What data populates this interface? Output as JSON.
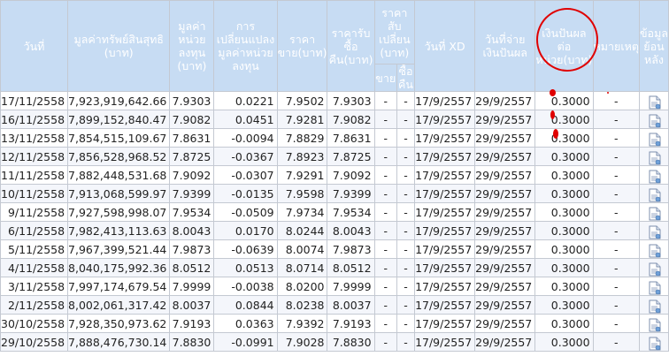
{
  "headers": {
    "date": "วันที่",
    "nav": "มูลค่าทรัพย์สินสุทธิ (บาท)",
    "nav_unit": "มูลค่า หน่วย ลงทุน (บาท)",
    "change": "การเปลี่ยนแปลง มูลค่าหน่วย ลงทุน",
    "sell": "ราคา ขาย(บาท)",
    "buyback": "ราคารับ ซื้อ คืน(บาท)",
    "switch": "ราคาสับ เปลี่ยน (บาท)",
    "switch_sell": "ขาย",
    "switch_buy": "ซื้อ คืน",
    "xd": "วันที่ XD",
    "paydate": "วันที่จ่าย เงินปันผล",
    "dividend": "เงินปันผล ต่อ หน่วย(บาท)",
    "remark": "หมายเหตุ",
    "history": "ข้อมูล ย้อน หลัง"
  },
  "rows": [
    {
      "date": "17/11/2558",
      "nav": "7,923,919,642.66",
      "unit": "7.9303",
      "change": "0.0221",
      "sell": "7.9502",
      "buy": "7.9303",
      "ssell": "-",
      "sbuy": "-",
      "xd": "17/9/2557",
      "pay": "29/9/2557",
      "div": "0.3000",
      "remark": "-"
    },
    {
      "date": "16/11/2558",
      "nav": "7,899,152,840.47",
      "unit": "7.9082",
      "change": "0.0451",
      "sell": "7.9281",
      "buy": "7.9082",
      "ssell": "-",
      "sbuy": "-",
      "xd": "17/9/2557",
      "pay": "29/9/2557",
      "div": "0.3000",
      "remark": "-"
    },
    {
      "date": "13/11/2558",
      "nav": "7,854,515,109.67",
      "unit": "7.8631",
      "change": "-0.0094",
      "sell": "7.8829",
      "buy": "7.8631",
      "ssell": "-",
      "sbuy": "-",
      "xd": "17/9/2557",
      "pay": "29/9/2557",
      "div": "0.3000",
      "remark": "-"
    },
    {
      "date": "12/11/2558",
      "nav": "7,856,528,968.52",
      "unit": "7.8725",
      "change": "-0.0367",
      "sell": "7.8923",
      "buy": "7.8725",
      "ssell": "-",
      "sbuy": "-",
      "xd": "17/9/2557",
      "pay": "29/9/2557",
      "div": "0.3000",
      "remark": "-"
    },
    {
      "date": "11/11/2558",
      "nav": "7,882,448,531.68",
      "unit": "7.9092",
      "change": "-0.0307",
      "sell": "7.9291",
      "buy": "7.9092",
      "ssell": "-",
      "sbuy": "-",
      "xd": "17/9/2557",
      "pay": "29/9/2557",
      "div": "0.3000",
      "remark": "-"
    },
    {
      "date": "10/11/2558",
      "nav": "7,913,068,599.97",
      "unit": "7.9399",
      "change": "-0.0135",
      "sell": "7.9598",
      "buy": "7.9399",
      "ssell": "-",
      "sbuy": "-",
      "xd": "17/9/2557",
      "pay": "29/9/2557",
      "div": "0.3000",
      "remark": "-"
    },
    {
      "date": "9/11/2558",
      "nav": "7,927,598,998.07",
      "unit": "7.9534",
      "change": "-0.0509",
      "sell": "7.9734",
      "buy": "7.9534",
      "ssell": "-",
      "sbuy": "-",
      "xd": "17/9/2557",
      "pay": "29/9/2557",
      "div": "0.3000",
      "remark": "-"
    },
    {
      "date": "6/11/2558",
      "nav": "7,982,413,113.63",
      "unit": "8.0043",
      "change": "0.0170",
      "sell": "8.0244",
      "buy": "8.0043",
      "ssell": "-",
      "sbuy": "-",
      "xd": "17/9/2557",
      "pay": "29/9/2557",
      "div": "0.3000",
      "remark": "-"
    },
    {
      "date": "5/11/2558",
      "nav": "7,967,399,521.44",
      "unit": "7.9873",
      "change": "-0.0639",
      "sell": "8.0074",
      "buy": "7.9873",
      "ssell": "-",
      "sbuy": "-",
      "xd": "17/9/2557",
      "pay": "29/9/2557",
      "div": "0.3000",
      "remark": "-"
    },
    {
      "date": "4/11/2558",
      "nav": "8,040,175,992.36",
      "unit": "8.0512",
      "change": "0.0513",
      "sell": "8.0714",
      "buy": "8.0512",
      "ssell": "-",
      "sbuy": "-",
      "xd": "17/9/2557",
      "pay": "29/9/2557",
      "div": "0.3000",
      "remark": "-"
    },
    {
      "date": "3/11/2558",
      "nav": "7,997,174,679.54",
      "unit": "7.9999",
      "change": "-0.0038",
      "sell": "8.0200",
      "buy": "7.9999",
      "ssell": "-",
      "sbuy": "-",
      "xd": "17/9/2557",
      "pay": "29/9/2557",
      "div": "0.3000",
      "remark": "-"
    },
    {
      "date": "2/11/2558",
      "nav": "8,002,061,317.42",
      "unit": "8.0037",
      "change": "0.0844",
      "sell": "8.0238",
      "buy": "8.0037",
      "ssell": "-",
      "sbuy": "-",
      "xd": "17/9/2557",
      "pay": "29/9/2557",
      "div": "0.3000",
      "remark": "-"
    },
    {
      "date": "30/10/2558",
      "nav": "7,928,350,973.62",
      "unit": "7.9193",
      "change": "0.0363",
      "sell": "7.9392",
      "buy": "7.9193",
      "ssell": "-",
      "sbuy": "-",
      "xd": "17/9/2557",
      "pay": "29/9/2557",
      "div": "0.3000",
      "remark": "-"
    },
    {
      "date": "29/10/2558",
      "nav": "7,888,476,730.14",
      "unit": "7.8830",
      "change": "-0.0991",
      "sell": "7.9028",
      "buy": "7.8830",
      "ssell": "-",
      "sbuy": "-",
      "xd": "17/9/2557",
      "pay": "29/9/2557",
      "div": "0.3000",
      "remark": "-"
    }
  ],
  "colors": {
    "header_bg": "#c7dcf3",
    "header_text": "#ffffff",
    "annotation": "#e00000"
  },
  "icons": {
    "history": "document-icon"
  }
}
